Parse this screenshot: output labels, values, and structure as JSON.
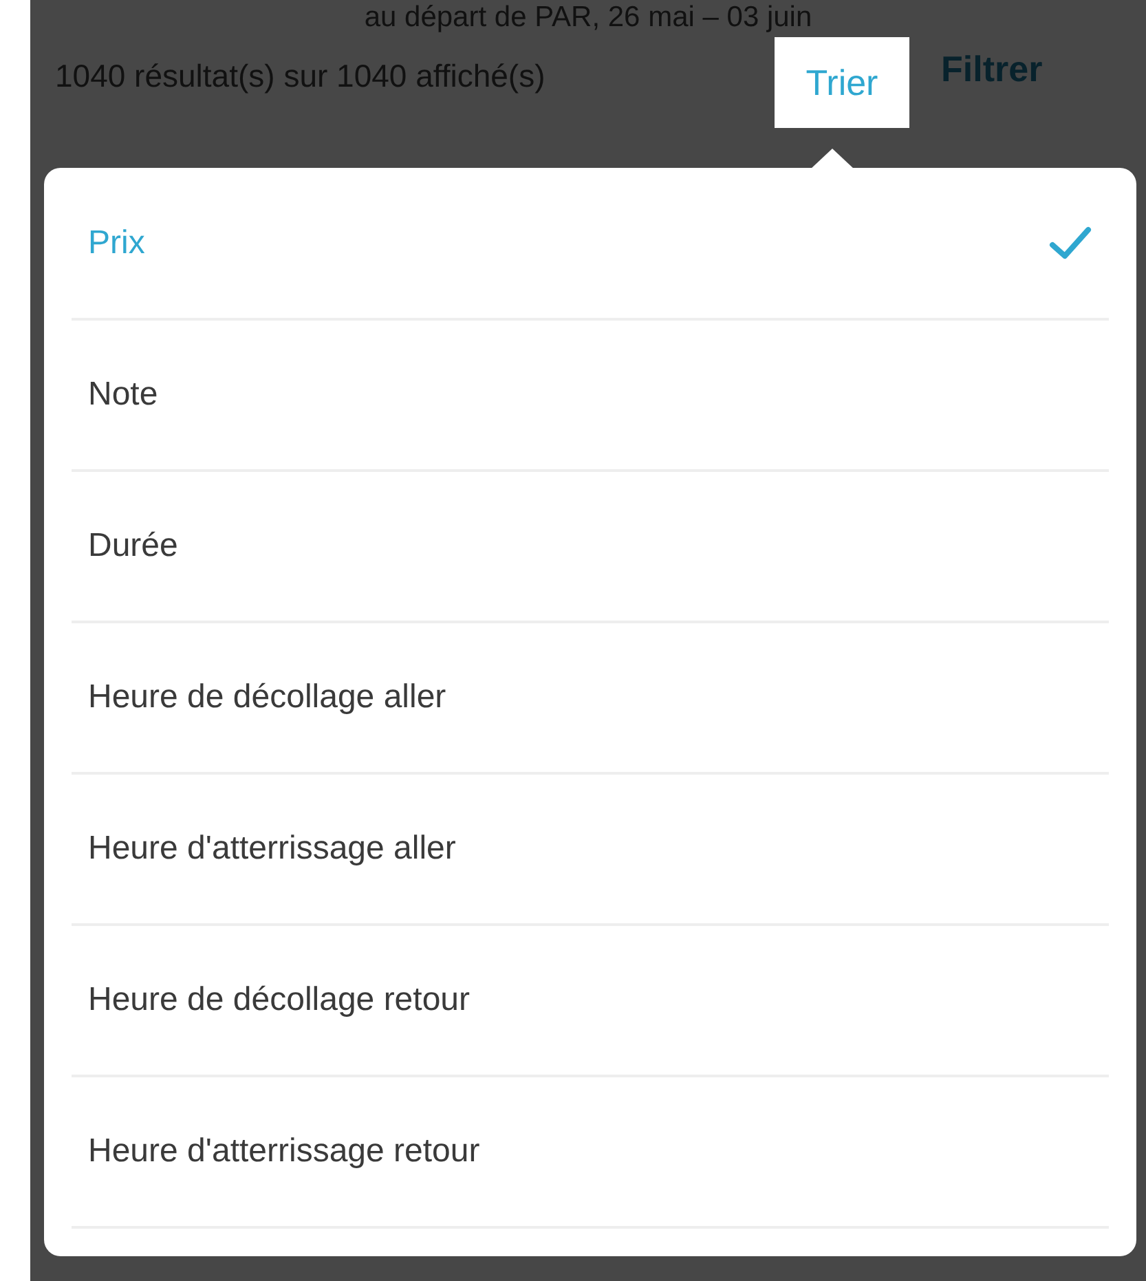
{
  "header": {
    "subtitle": "au départ de PAR, 26 mai – 03 juin",
    "result_count": "1040 résultat(s) sur 1040 affiché(s)",
    "sort_button": "Trier",
    "filter_button": "Filtrer"
  },
  "sort_options": [
    {
      "label": "Prix",
      "selected": true
    },
    {
      "label": "Note",
      "selected": false
    },
    {
      "label": "Durée",
      "selected": false
    },
    {
      "label": "Heure de décollage aller",
      "selected": false
    },
    {
      "label": "Heure d'atterrissage aller",
      "selected": false
    },
    {
      "label": "Heure de décollage retour",
      "selected": false
    },
    {
      "label": "Heure d'atterrissage retour",
      "selected": false
    }
  ]
}
